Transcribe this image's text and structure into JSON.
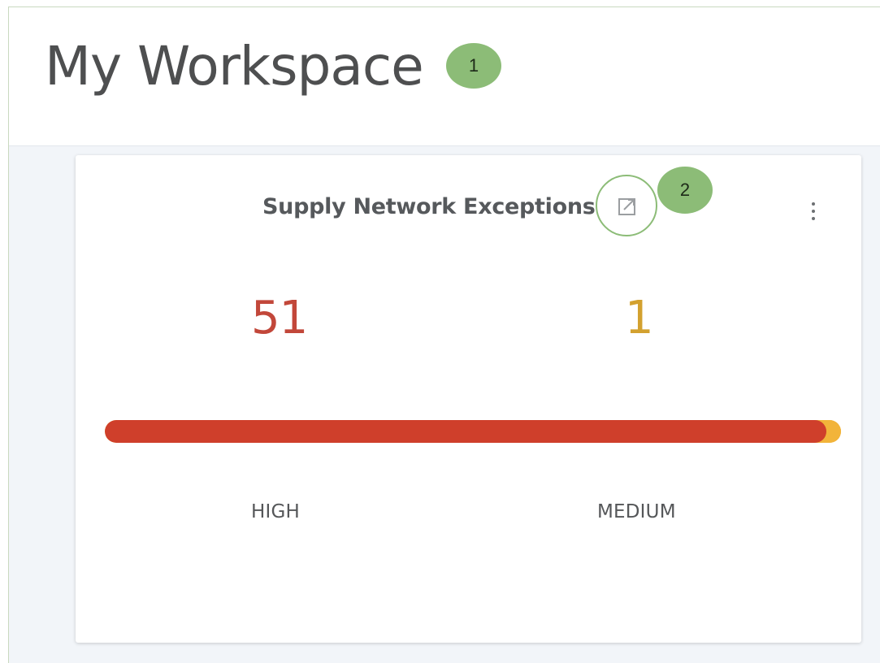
{
  "header": {
    "title": "My Workspace",
    "callout_1": "1"
  },
  "card": {
    "title": "Supply Network Exceptions",
    "open_icon": "open-in-new-icon",
    "menu_icon": "more-vertical-icon",
    "callout_2": "2",
    "high": {
      "count": "51",
      "label": "HIGH",
      "color": "#cf3f2b"
    },
    "medium": {
      "count": "1",
      "label": "MEDIUM",
      "color": "#f2b43a"
    },
    "bar": {
      "high_fraction": 0.98,
      "medium_fraction": 0.02
    }
  },
  "colors": {
    "callout": "#8cbc77",
    "high_text": "#c2473a",
    "medium_text": "#d3a12f"
  }
}
